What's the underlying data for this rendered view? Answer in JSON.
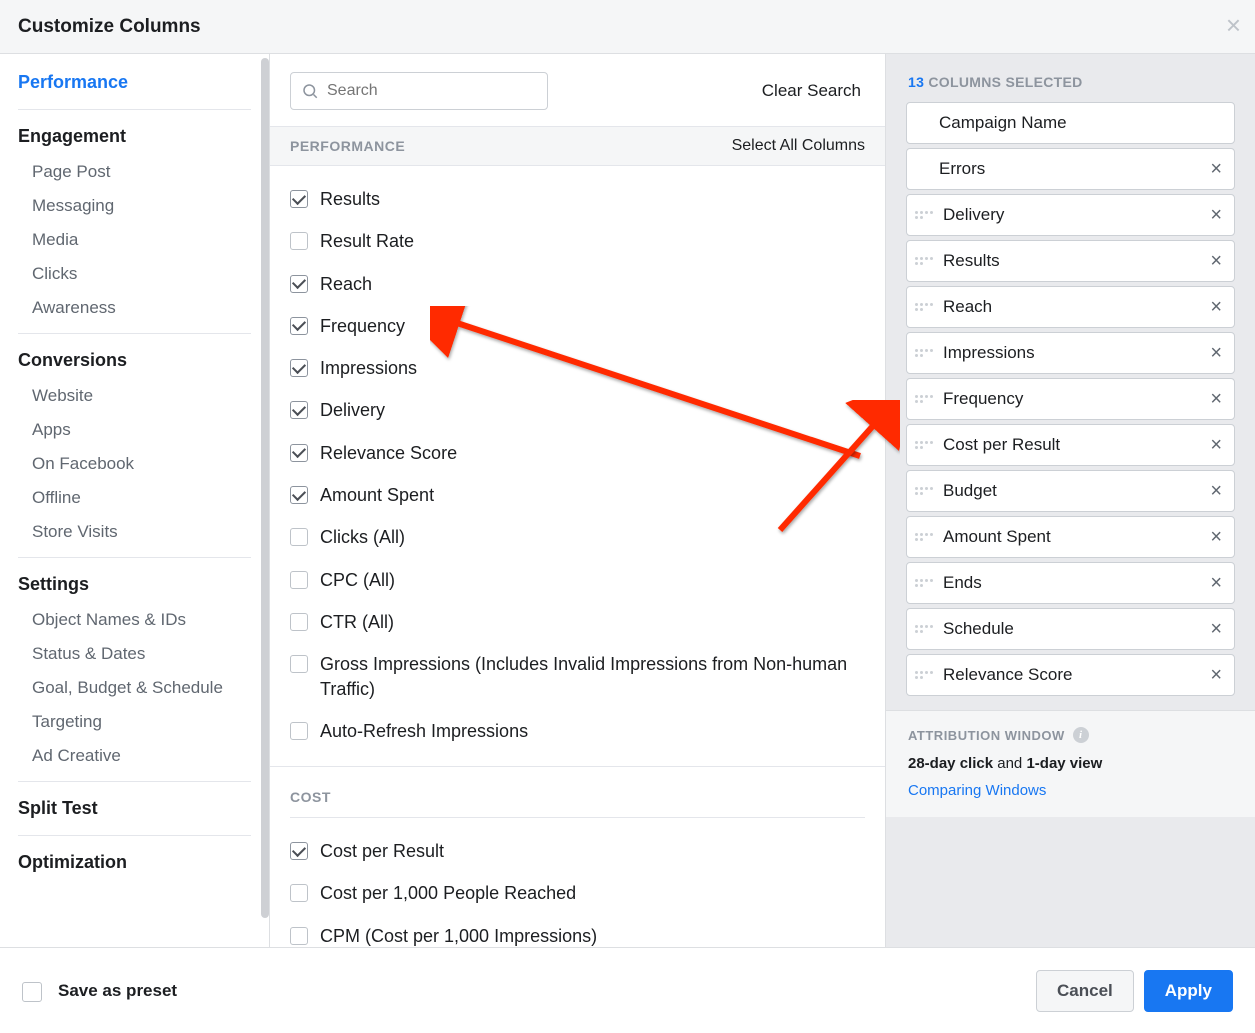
{
  "header": {
    "title": "Customize Columns"
  },
  "sidebar": {
    "groups": [
      {
        "label": "Performance",
        "active": true,
        "subs": []
      },
      {
        "label": "Engagement",
        "subs": [
          "Page Post",
          "Messaging",
          "Media",
          "Clicks",
          "Awareness"
        ]
      },
      {
        "label": "Conversions",
        "subs": [
          "Website",
          "Apps",
          "On Facebook",
          "Offline",
          "Store Visits"
        ]
      },
      {
        "label": "Settings",
        "subs": [
          "Object Names & IDs",
          "Status & Dates",
          "Goal, Budget & Schedule",
          "Targeting",
          "Ad Creative"
        ]
      },
      {
        "label": "Split Test",
        "subs": []
      },
      {
        "label": "Optimization",
        "subs": []
      }
    ]
  },
  "search": {
    "placeholder": "Search",
    "clear_label": "Clear Search"
  },
  "sections": [
    {
      "title": "PERFORMANCE",
      "select_all": "Select All Columns",
      "items": [
        {
          "label": "Results",
          "checked": true
        },
        {
          "label": "Result Rate",
          "checked": false
        },
        {
          "label": "Reach",
          "checked": true
        },
        {
          "label": "Frequency",
          "checked": true
        },
        {
          "label": "Impressions",
          "checked": true
        },
        {
          "label": "Delivery",
          "checked": true
        },
        {
          "label": "Relevance Score",
          "checked": true
        },
        {
          "label": "Amount Spent",
          "checked": true
        },
        {
          "label": "Clicks (All)",
          "checked": false
        },
        {
          "label": "CPC (All)",
          "checked": false
        },
        {
          "label": "CTR (All)",
          "checked": false
        },
        {
          "label": "Gross Impressions (Includes Invalid Impressions from Non-human Traffic)",
          "checked": false
        },
        {
          "label": "Auto-Refresh Impressions",
          "checked": false
        }
      ]
    },
    {
      "title": "COST",
      "items": [
        {
          "label": "Cost per Result",
          "checked": true
        },
        {
          "label": "Cost per 1,000 People Reached",
          "checked": false
        },
        {
          "label": "CPM (Cost per 1,000 Impressions)",
          "checked": false
        }
      ]
    }
  ],
  "selected": {
    "count": "13",
    "heading": "COLUMNS SELECTED",
    "chips": [
      {
        "label": "Campaign Name",
        "fixed": true,
        "removable": false
      },
      {
        "label": "Errors",
        "fixed": true,
        "removable": true
      },
      {
        "label": "Delivery",
        "removable": true
      },
      {
        "label": "Results",
        "removable": true
      },
      {
        "label": "Reach",
        "removable": true
      },
      {
        "label": "Impressions",
        "removable": true
      },
      {
        "label": "Frequency",
        "removable": true
      },
      {
        "label": "Cost per Result",
        "removable": true
      },
      {
        "label": "Budget",
        "removable": true
      },
      {
        "label": "Amount Spent",
        "removable": true
      },
      {
        "label": "Ends",
        "removable": true
      },
      {
        "label": "Schedule",
        "removable": true
      },
      {
        "label": "Relevance Score",
        "removable": true
      }
    ]
  },
  "attribution": {
    "title": "ATTRIBUTION WINDOW",
    "line_parts": {
      "click": "28-day click",
      "and": " and ",
      "view": "1-day view"
    },
    "link": "Comparing Windows"
  },
  "footer": {
    "save_preset": "Save as preset",
    "cancel": "Cancel",
    "apply": "Apply"
  }
}
